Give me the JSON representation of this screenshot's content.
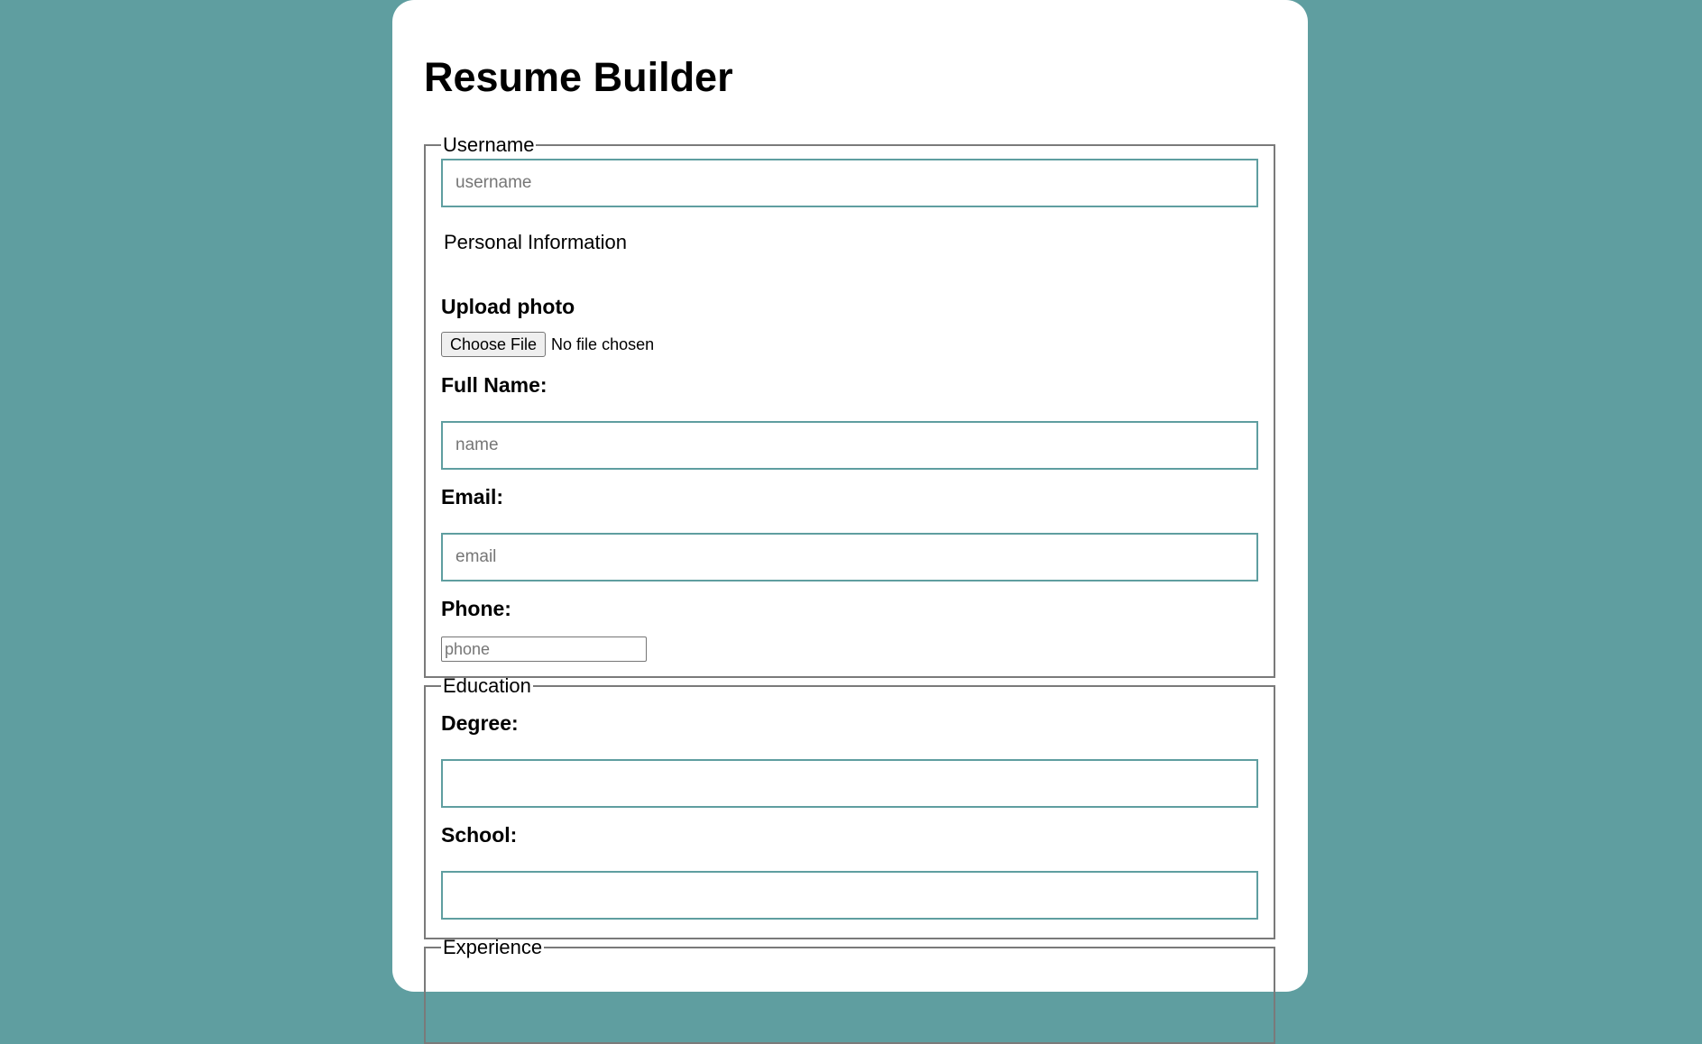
{
  "page": {
    "title": "Resume Builder",
    "background_color": "#5f9ea0",
    "accent_color": "#5f9ea0"
  },
  "username_section": {
    "legend": "Username",
    "username_input": {
      "placeholder": "username",
      "value": ""
    },
    "personal_heading": "Personal Information",
    "upload_label": "Upload photo",
    "file_button_label": "Choose File",
    "file_status": "No file chosen",
    "full_name_label": "Full Name:",
    "name_input": {
      "placeholder": "name",
      "value": ""
    },
    "email_label": "Email:",
    "email_input": {
      "placeholder": "email",
      "value": ""
    },
    "phone_label": "Phone:",
    "phone_input": {
      "placeholder": "phone",
      "value": ""
    }
  },
  "education_section": {
    "legend": "Education",
    "degree_label": "Degree:",
    "degree_input": {
      "value": ""
    },
    "school_label": "School:",
    "school_input": {
      "value": ""
    }
  },
  "experience_section": {
    "legend": "Experience"
  }
}
